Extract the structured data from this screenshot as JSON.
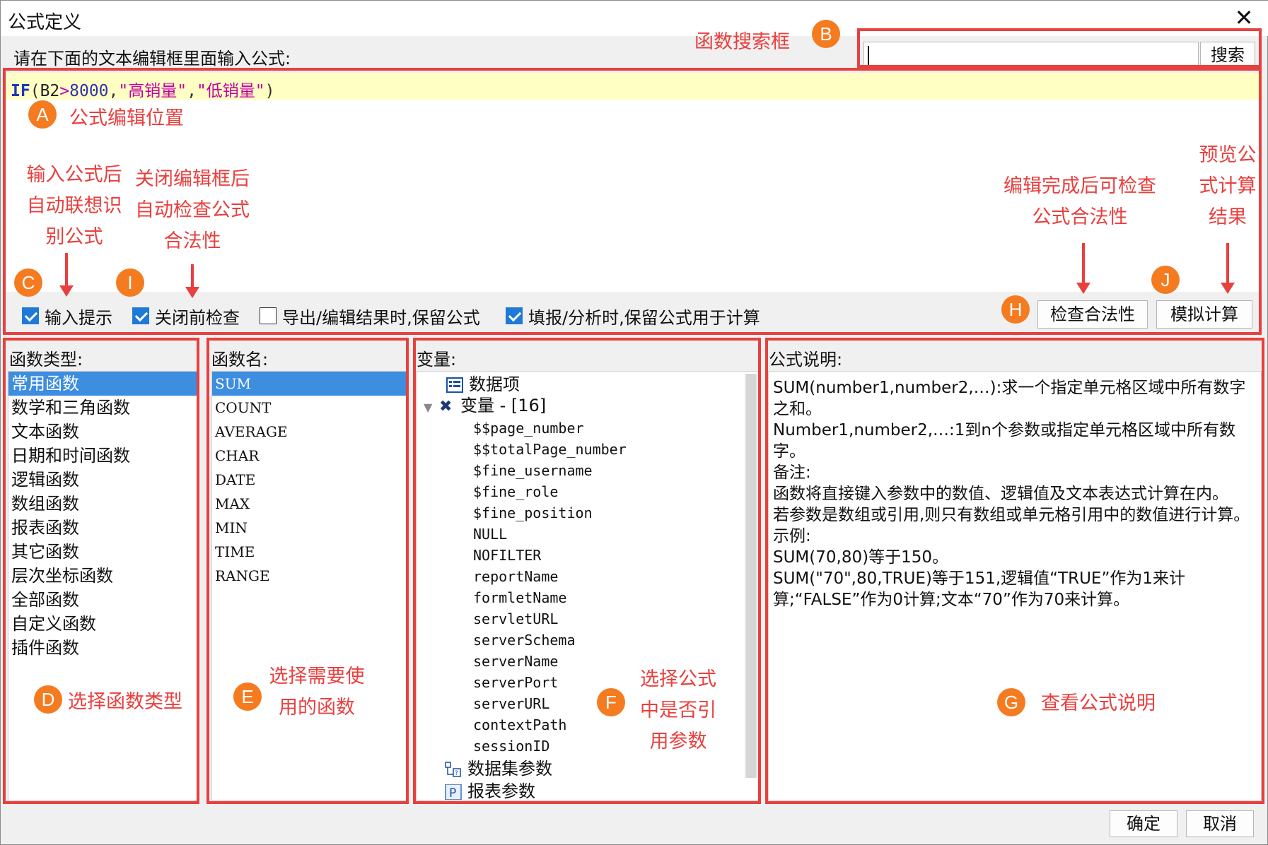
{
  "window": {
    "title": "公式定义",
    "close_glyph": "✕"
  },
  "prompt": "请在下面的文本编辑框里面输入公式:",
  "search": {
    "value": "",
    "button": "搜索"
  },
  "formula": {
    "fn": "IF",
    "open": "(",
    "ref": "B2",
    "op": ">",
    "num": "8000",
    "comma1": ",",
    "str1": "\"高销量\"",
    "comma2": ",",
    "str2": "\"低销量\"",
    "close": ")"
  },
  "checkboxes": [
    {
      "label": "输入提示",
      "checked": true
    },
    {
      "label": "关闭前检查",
      "checked": true
    },
    {
      "label": "导出/编辑结果时,保留公式",
      "checked": false
    },
    {
      "label": "填报/分析时,保留公式用于计算",
      "checked": true
    }
  ],
  "buttons": {
    "check": "检查合法性",
    "simulate": "模拟计算",
    "ok": "确定",
    "cancel": "取消"
  },
  "panels": {
    "function_type_label": "函数类型:",
    "function_name_label": "函数名:",
    "variable_label": "变量:",
    "description_label": "公式说明:"
  },
  "function_types": [
    "常用函数",
    "数学和三角函数",
    "文本函数",
    "日期和时间函数",
    "逻辑函数",
    "数组函数",
    "报表函数",
    "其它函数",
    "层次坐标函数",
    "全部函数",
    "自定义函数",
    "插件函数"
  ],
  "function_names": [
    "SUM",
    "COUNT",
    "AVERAGE",
    "CHAR",
    "DATE",
    "MAX",
    "MIN",
    "TIME",
    "RANGE"
  ],
  "variables": {
    "data_item": "数据项",
    "variable_node": "变量 - [16]",
    "children": [
      "$$page_number",
      "$$totalPage_number",
      "$fine_username",
      "$fine_role",
      "$fine_position",
      "NULL",
      "NOFILTER",
      "reportName",
      "formletName",
      "servletURL",
      "serverSchema",
      "serverName",
      "serverPort",
      "serverURL",
      "contextPath",
      "sessionID"
    ],
    "dataset_params": "数据集参数",
    "report_params": "报表参数"
  },
  "description": [
    "SUM(number1,number2,…):求一个指定单元格区域中所有数字之和。",
    "Number1,number2,…:1到n个参数或指定单元格区域中所有数字。",
    "备注:",
    "函数将直接键入参数中的数值、逻辑值及文本表达式计算在内。",
    "若参数是数组或引用,则只有数组或单元格引用中的数值进行计算。",
    "示例:",
    "SUM(70,80)等于150。",
    "SUM(\"70\",80,TRUE)等于151,逻辑值“TRUE”作为1来计算;“FALSE”作为0计算;文本“70”作为70来计算。"
  ],
  "annotations": {
    "A": "公式编辑位置",
    "B": "函数搜索框",
    "C": "输入公式后\n自动联想识\n别公式",
    "I": "关闭编辑框后\n自动检查公式\n合法性",
    "H": "编辑完成后可检查\n公式合法性",
    "J": "预览公\n式计算\n结果",
    "D": "选择函数类型",
    "E": "选择需要使\n用的函数",
    "F": "选择公式\n中是否引\n用参数",
    "G": "查看公式说明"
  },
  "badges": {
    "A": "A",
    "B": "B",
    "C": "C",
    "I": "I",
    "H": "H",
    "J": "J",
    "D": "D",
    "E": "E",
    "F": "F",
    "G": "G"
  },
  "colors": {
    "accent_red": "#e8403e",
    "badge_orange": "#f47b20",
    "selection_blue": "#3d8de0",
    "editor_highlight": "#ffffc4"
  }
}
